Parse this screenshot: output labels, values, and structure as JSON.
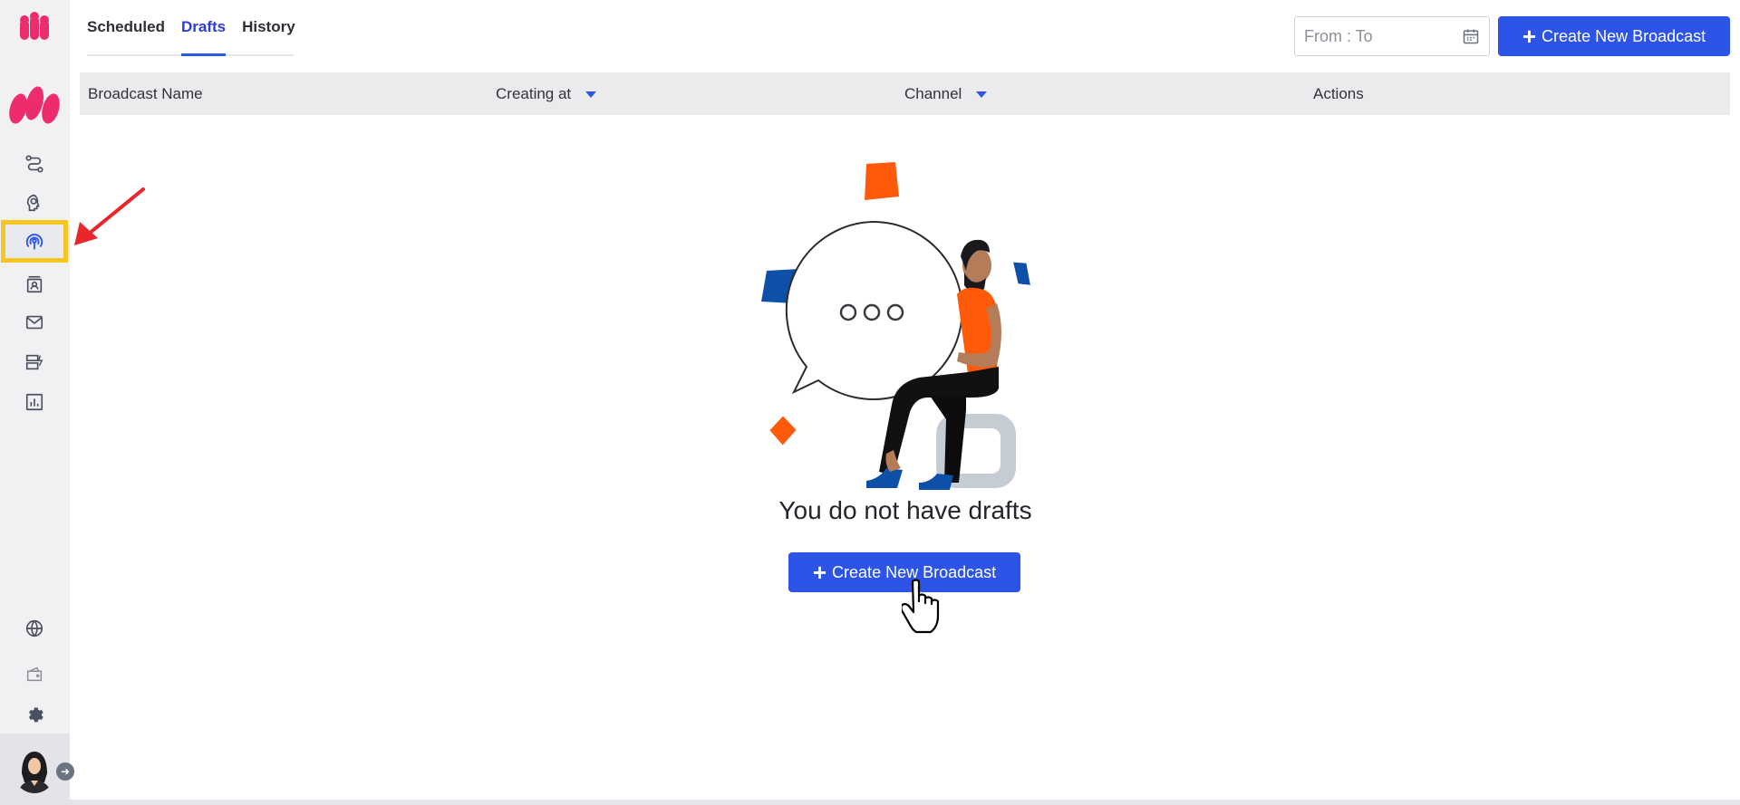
{
  "tabs": [
    {
      "label": "Scheduled",
      "active": false
    },
    {
      "label": "Drafts",
      "active": true
    },
    {
      "label": "History",
      "active": false
    }
  ],
  "date_range": {
    "placeholder": "From : To"
  },
  "create_button": {
    "label": "Create New Broadcast"
  },
  "table": {
    "columns": [
      {
        "label": "Broadcast Name",
        "sortable": false
      },
      {
        "label": "Creating at",
        "sortable": true
      },
      {
        "label": "Channel",
        "sortable": true
      },
      {
        "label": "Actions",
        "sortable": false
      }
    ]
  },
  "empty_state": {
    "message": "You do not have drafts",
    "button_label": "Create New Broadcast"
  },
  "sidebar": {
    "items": [
      {
        "icon": "flow-icon"
      },
      {
        "icon": "bot-icon"
      },
      {
        "icon": "broadcast-icon",
        "active": true
      },
      {
        "icon": "contacts-icon"
      },
      {
        "icon": "mail-icon"
      },
      {
        "icon": "templates-icon"
      },
      {
        "icon": "analytics-icon"
      }
    ],
    "bottom_items": [
      {
        "icon": "globe-icon"
      },
      {
        "icon": "wallet-icon"
      },
      {
        "icon": "gear-icon"
      }
    ]
  },
  "colors": {
    "accent": "#2c55e8",
    "brand": "#ee2b6c",
    "highlight": "#f7c520",
    "annotation": "#e8262b"
  }
}
